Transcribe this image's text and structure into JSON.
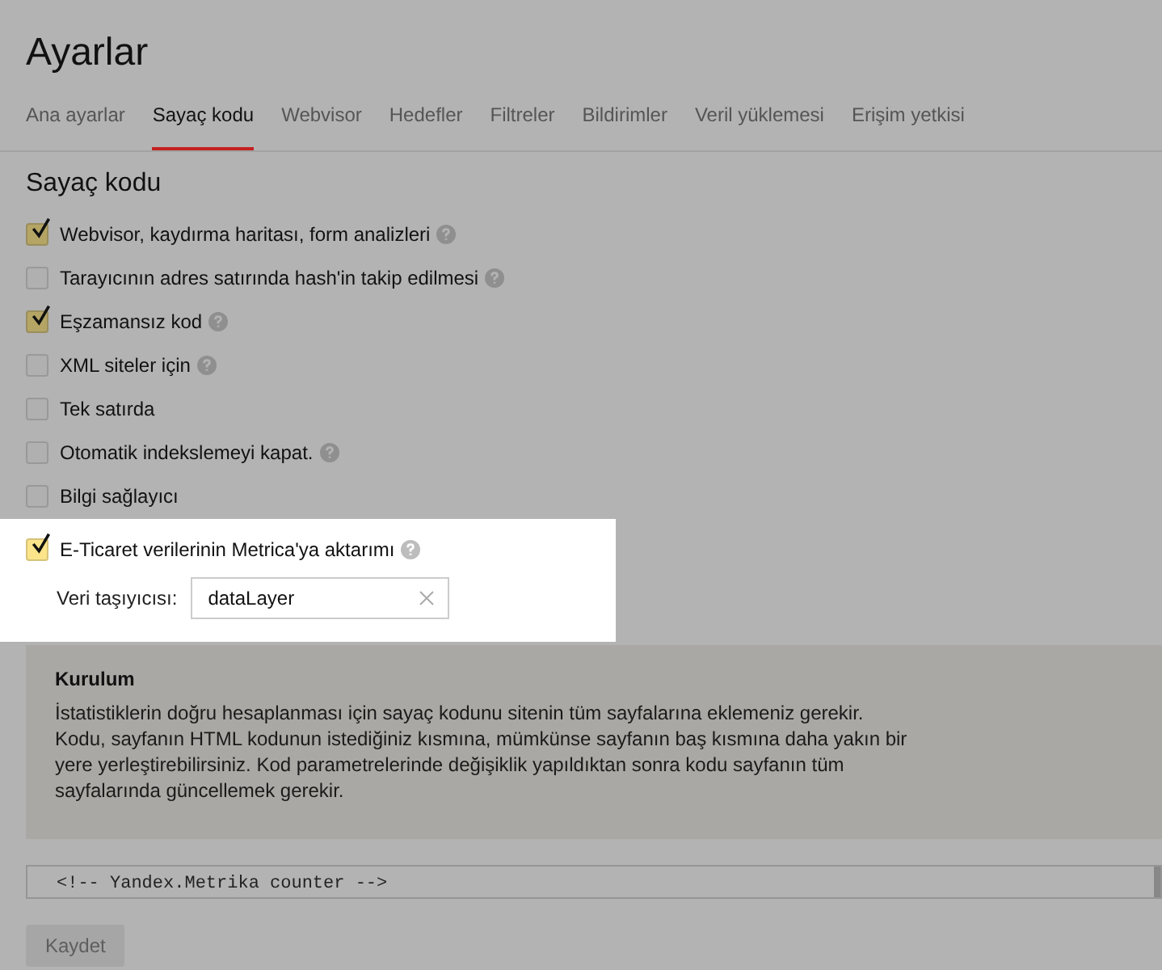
{
  "title": "Ayarlar",
  "tabs": [
    {
      "label": "Ana ayarlar",
      "selected": false
    },
    {
      "label": "Sayaç kodu",
      "selected": true
    },
    {
      "label": "Webvisor",
      "selected": false
    },
    {
      "label": "Hedefler",
      "selected": false
    },
    {
      "label": "Filtreler",
      "selected": false
    },
    {
      "label": "Bildirimler",
      "selected": false
    },
    {
      "label": "Veril yüklemesi",
      "selected": false
    },
    {
      "label": "Erişim yetkisi",
      "selected": false
    }
  ],
  "section_title": "Sayaç kodu",
  "options": [
    {
      "label": "Webvisor, kaydırma haritası, form analizleri",
      "checked": true,
      "help": true
    },
    {
      "label": "Tarayıcının adres satırında hash'in takip edilmesi",
      "checked": false,
      "help": true
    },
    {
      "label": "Eşzamansız kod",
      "checked": true,
      "help": true
    },
    {
      "label": "XML siteler için",
      "checked": false,
      "help": true
    },
    {
      "label": "Tek satırda",
      "checked": false,
      "help": false
    },
    {
      "label": "Otomatik indekslemeyi kapat.",
      "checked": false,
      "help": true
    },
    {
      "label": "Bilgi sağlayıcı",
      "checked": false,
      "help": false
    }
  ],
  "ecommerce": {
    "highlighted": true,
    "label": "E-Ticaret verilerinin Metrica'ya aktarımı",
    "checked": true,
    "help": true,
    "field_label": "Veri taşıyıcısı:",
    "field_value": "dataLayer"
  },
  "install": {
    "title": "Kurulum",
    "text": "İstatistiklerin doğru hesaplanması için sayaç kodunu sitenin tüm sayfalarına eklemeniz gerekir. Kodu, sayfanın HTML kodunun istediğiniz kısmına, mümkünse sayfanın baş kısmına daha yakın bir yere yerleştirebilirsiniz. Kod parametrelerinde değişiklik yapıldıktan sonra kodu sayfanın tüm sayfalarında güncellemek gerekir."
  },
  "code": "<!-- Yandex.Metrika counter -->",
  "save_button": {
    "label": "Kaydet",
    "disabled": true
  }
}
